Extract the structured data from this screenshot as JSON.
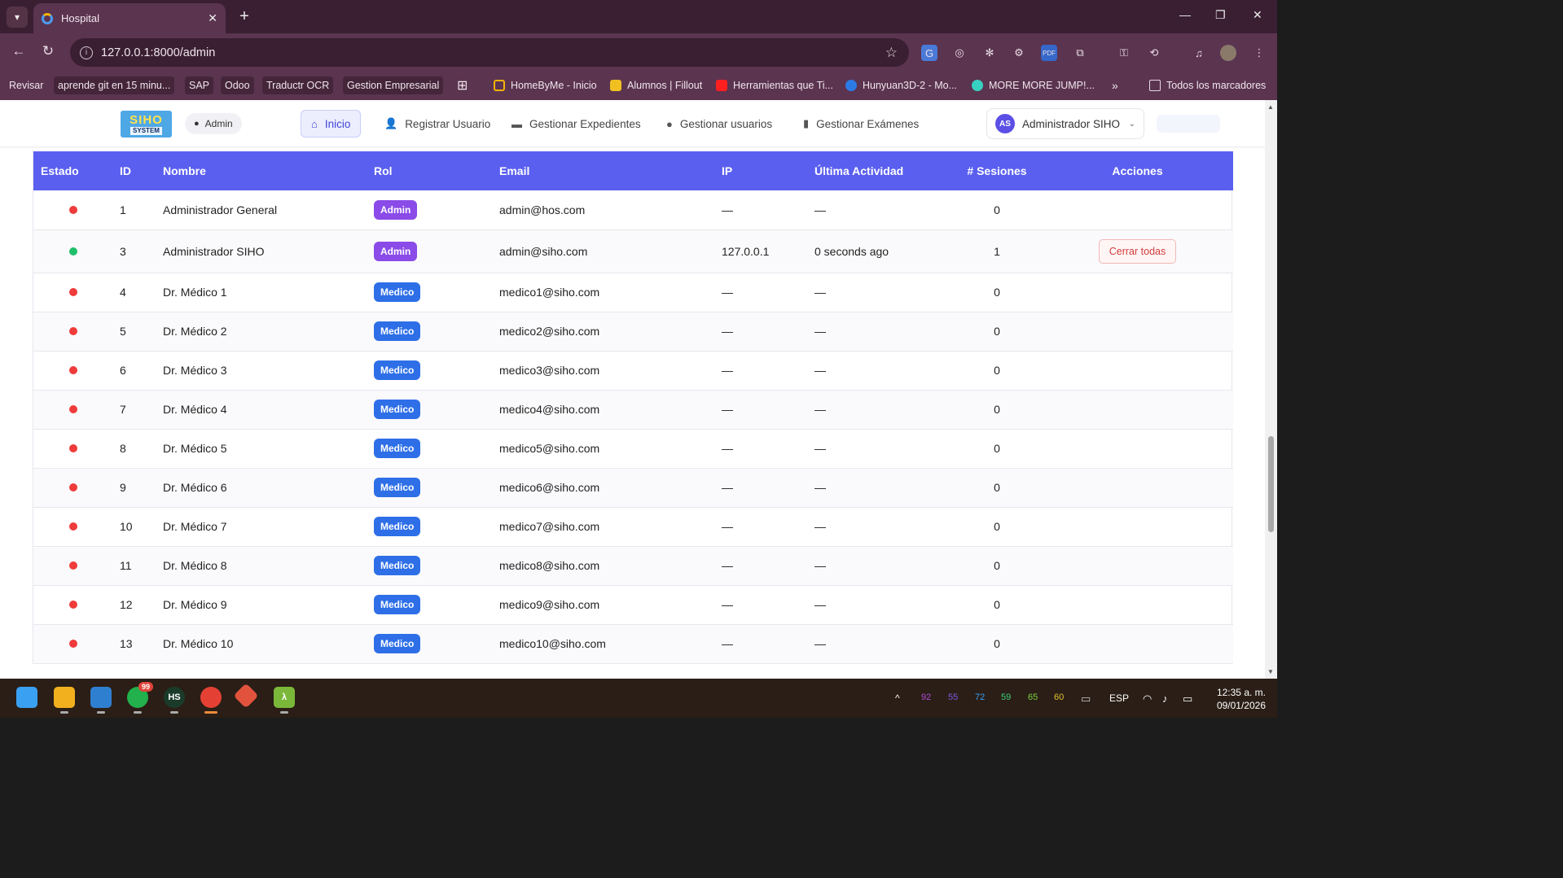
{
  "browser": {
    "tab_title": "Hospital",
    "url": "127.0.0.1:8000/admin",
    "bookmarks": [
      {
        "label": "Revisar"
      },
      {
        "label": "aprende git en 15 minu..."
      },
      {
        "label": "SAP"
      },
      {
        "label": "Odoo"
      },
      {
        "label": "Traductr OCR"
      },
      {
        "label": "Gestion Empresarial"
      },
      {
        "label": "HomeByMe - Inicio"
      },
      {
        "label": "Alumnos | Fillout"
      },
      {
        "label": "Herramientas que Ti..."
      },
      {
        "label": "Hunyuan3D-2 - Mo..."
      },
      {
        "label": "MORE MORE JUMP!..."
      },
      {
        "label": "Todos los marcadores"
      }
    ]
  },
  "app": {
    "logo_line1": "SIHO",
    "logo_line2": "SYSTEM",
    "role_pill": "Admin",
    "nav": {
      "inicio": "Inicio",
      "registrar": "Registrar Usuario",
      "expedientes": "Gestionar Expedientes",
      "usuarios": "Gestionar usuarios",
      "examenes": "Gestionar Exámenes"
    },
    "user": {
      "initials": "AS",
      "name": "Administrador SIHO"
    }
  },
  "table": {
    "headers": {
      "estado": "Estado",
      "id": "ID",
      "nombre": "Nombre",
      "rol": "Rol",
      "email": "Email",
      "ip": "IP",
      "ultima": "Última Actividad",
      "sesiones": "# Sesiones",
      "acciones": "Acciones"
    },
    "action_label": "Cerrar todas",
    "rows": [
      {
        "status": "offline",
        "id": "1",
        "name": "Administrador General",
        "role": "Admin",
        "email": "admin@hos.com",
        "ip": "—",
        "last": "—",
        "sessions": "0",
        "action": false
      },
      {
        "status": "online",
        "id": "3",
        "name": "Administrador SIHO",
        "role": "Admin",
        "email": "admin@siho.com",
        "ip": "127.0.0.1",
        "last": "0 seconds ago",
        "sessions": "1",
        "action": true
      },
      {
        "status": "offline",
        "id": "4",
        "name": "Dr. Médico 1",
        "role": "Medico",
        "email": "medico1@siho.com",
        "ip": "—",
        "last": "—",
        "sessions": "0",
        "action": false
      },
      {
        "status": "offline",
        "id": "5",
        "name": "Dr. Médico 2",
        "role": "Medico",
        "email": "medico2@siho.com",
        "ip": "—",
        "last": "—",
        "sessions": "0",
        "action": false
      },
      {
        "status": "offline",
        "id": "6",
        "name": "Dr. Médico 3",
        "role": "Medico",
        "email": "medico3@siho.com",
        "ip": "—",
        "last": "—",
        "sessions": "0",
        "action": false
      },
      {
        "status": "offline",
        "id": "7",
        "name": "Dr. Médico 4",
        "role": "Medico",
        "email": "medico4@siho.com",
        "ip": "—",
        "last": "—",
        "sessions": "0",
        "action": false
      },
      {
        "status": "offline",
        "id": "8",
        "name": "Dr. Médico 5",
        "role": "Medico",
        "email": "medico5@siho.com",
        "ip": "—",
        "last": "—",
        "sessions": "0",
        "action": false
      },
      {
        "status": "offline",
        "id": "9",
        "name": "Dr. Médico 6",
        "role": "Medico",
        "email": "medico6@siho.com",
        "ip": "—",
        "last": "—",
        "sessions": "0",
        "action": false
      },
      {
        "status": "offline",
        "id": "10",
        "name": "Dr. Médico 7",
        "role": "Medico",
        "email": "medico7@siho.com",
        "ip": "—",
        "last": "—",
        "sessions": "0",
        "action": false
      },
      {
        "status": "offline",
        "id": "11",
        "name": "Dr. Médico 8",
        "role": "Medico",
        "email": "medico8@siho.com",
        "ip": "—",
        "last": "—",
        "sessions": "0",
        "action": false
      },
      {
        "status": "offline",
        "id": "12",
        "name": "Dr. Médico 9",
        "role": "Medico",
        "email": "medico9@siho.com",
        "ip": "—",
        "last": "—",
        "sessions": "0",
        "action": false
      },
      {
        "status": "offline",
        "id": "13",
        "name": "Dr. Médico 10",
        "role": "Medico",
        "email": "medico10@siho.com",
        "ip": "—",
        "last": "—",
        "sessions": "0",
        "action": false
      }
    ]
  },
  "colors": {
    "header": "#5a5ff0",
    "online": "#1fbf6a",
    "offline": "#ef3b3b",
    "role_admin": "#8a4be8",
    "role_medico": "#2e6fe8"
  },
  "taskbar": {
    "whatsapp_badge": "99",
    "tray_numbers": [
      "92",
      "55",
      "72",
      "59",
      "65",
      "60"
    ],
    "language": "ESP",
    "time": "12:35 a. m.",
    "date": "09/01/2026"
  }
}
